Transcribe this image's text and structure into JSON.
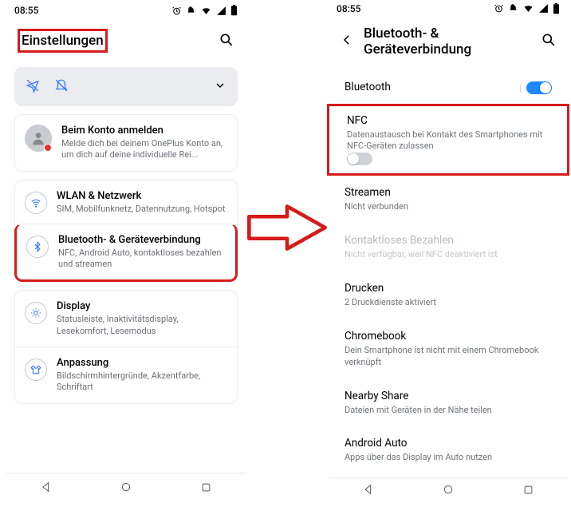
{
  "statusbar": {
    "time": "08:55"
  },
  "left": {
    "title": "Einstellungen",
    "account": {
      "title": "Beim Konto anmelden",
      "sub": "Melde dich bei deinem OnePlus Konto an, um dich auf deine individuelle Rei..."
    },
    "net": {
      "wlan": {
        "title": "WLAN & Netzwerk",
        "sub": "SIM, Mobilfunknetz, Datennutzung, Hotspot"
      },
      "bt": {
        "title": "Bluetooth- & Geräteverbindung",
        "sub": "NFC, Android Auto, kontaktloses bezahlen und streamen"
      }
    },
    "display": {
      "title": "Display",
      "sub": "Statusleiste, Inaktivitätsdisplay, Lesekomfort, Lesemodus"
    },
    "custom": {
      "title": "Anpassung",
      "sub": "Bildschirmhintergründe, Akzentfarbe, Schriftart"
    }
  },
  "right": {
    "title": "Bluetooth- & Geräteverbindung",
    "bluetooth": {
      "title": "Bluetooth"
    },
    "nfc": {
      "title": "NFC",
      "sub": "Datenaustausch bei Kontakt des Smartphones mit NFC-Geräten zulassen"
    },
    "stream": {
      "title": "Streamen",
      "sub": "Nicht verbunden"
    },
    "pay": {
      "title": "Kontaktloses Bezahlen",
      "sub": "Nicht verfügbar, weil NFC deaktiviert ist"
    },
    "print": {
      "title": "Drucken",
      "sub": "2 Druckdienste aktiviert"
    },
    "chrome": {
      "title": "Chromebook",
      "sub": "Dein Smartphone ist nicht mit einem Chromebook verknüpft"
    },
    "share": {
      "title": "Nearby Share",
      "sub": "Dateien mit Geräten in der Nähe teilen"
    },
    "auto": {
      "title": "Android Auto",
      "sub": "Apps über das Display im Auto nutzen"
    }
  }
}
